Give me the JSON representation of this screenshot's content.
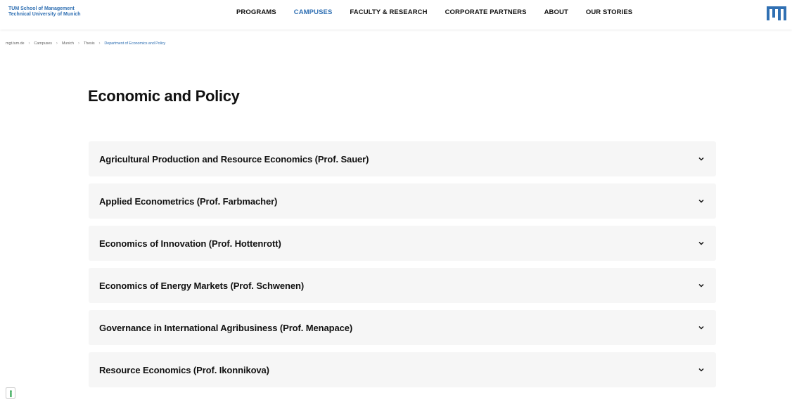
{
  "header": {
    "school_line1": "TUM School of Management",
    "school_line2": "Technical University of Munich",
    "nav": [
      {
        "label": "PROGRAMS",
        "active": false
      },
      {
        "label": "CAMPUSES",
        "active": true
      },
      {
        "label": "FACULTY & RESEARCH",
        "active": false
      },
      {
        "label": "CORPORATE PARTNERS",
        "active": false
      },
      {
        "label": "ABOUT",
        "active": false
      },
      {
        "label": "OUR STORIES",
        "active": false
      }
    ],
    "logo_icon": "tum-logo-icon"
  },
  "breadcrumb": [
    "mgt.tum.de",
    "Campuses",
    "Munich",
    "Thesis",
    "Department of Economics and Policy"
  ],
  "page_title": "Economic and Policy",
  "accordion": [
    "Agricultural Production and Resource Economics (Prof. Sauer)",
    "Applied Econometrics (Prof. Farbmacher)",
    "Economics of Innovation (Prof. Hottenrott)",
    "Economics of Energy Markets (Prof. Schwenen)",
    "Governance in International Agribusiness (Prof. Menapace)",
    "Resource Economics (Prof. Ikonnikova)"
  ],
  "colors": {
    "accent": "#3070b3",
    "panel": "#f6f6f6",
    "text": "#111111"
  }
}
